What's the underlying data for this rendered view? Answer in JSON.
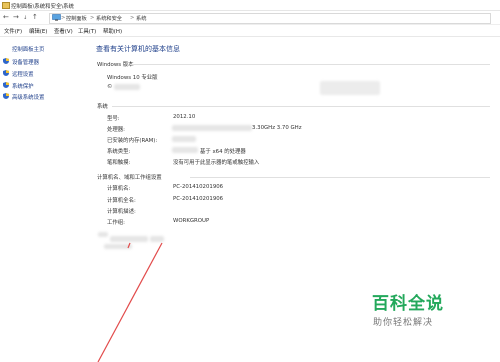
{
  "window": {
    "title": "控制面板\\系统和安全\\系统"
  },
  "address_bar": {
    "nav": [
      "←",
      "→",
      "↓",
      "↑"
    ],
    "crumbs": [
      "控制面板",
      "系统和安全",
      "系统"
    ],
    "sep": ">"
  },
  "menu": [
    "文件(F)",
    "编辑(E)",
    "查看(V)",
    "工具(T)",
    "帮助(H)"
  ],
  "sidebar": {
    "home": "控制面板主页",
    "items": [
      {
        "label": "设备管理器",
        "icon": "shield-icon"
      },
      {
        "label": "远程设置",
        "icon": "shield-icon"
      },
      {
        "label": "系统保护",
        "icon": "shield-icon"
      },
      {
        "label": "高级系统设置",
        "icon": "shield-icon"
      }
    ]
  },
  "main": {
    "heading": "查看有关计算机的基本信息",
    "windows_edition": {
      "section": "Windows 版本",
      "edition": "Windows 10 专业版",
      "copyright_prefix": "©"
    },
    "system": {
      "section": "系统",
      "rows": [
        {
          "label": "型号:",
          "value": "2012.10"
        },
        {
          "label": "处理器:",
          "value": "3.30GHz  3.70 GHz"
        },
        {
          "label": "已安装的内存(RAM):",
          "value": ""
        },
        {
          "label": "系统类型:",
          "value": "基于 x64 的处理器"
        },
        {
          "label": "笔和触摸:",
          "value": "没有可用于此显示器的笔或触控输入"
        }
      ]
    },
    "computer": {
      "section": "计算机名、域和工作组设置",
      "rows": [
        {
          "label": "计算机名:",
          "value": "PC-201410201906"
        },
        {
          "label": "计算机全名:",
          "value": "PC-201410201906"
        },
        {
          "label": "计算机描述:",
          "value": ""
        },
        {
          "label": "工作组:",
          "value": "WORKGROUP"
        }
      ]
    }
  },
  "watermark": {
    "main": "百科全说",
    "sub": "助你轻松解决"
  },
  "colors": {
    "link": "#1e3f8a",
    "watermark_green": "#23a85b",
    "annotation_red": "#e24b4b"
  }
}
